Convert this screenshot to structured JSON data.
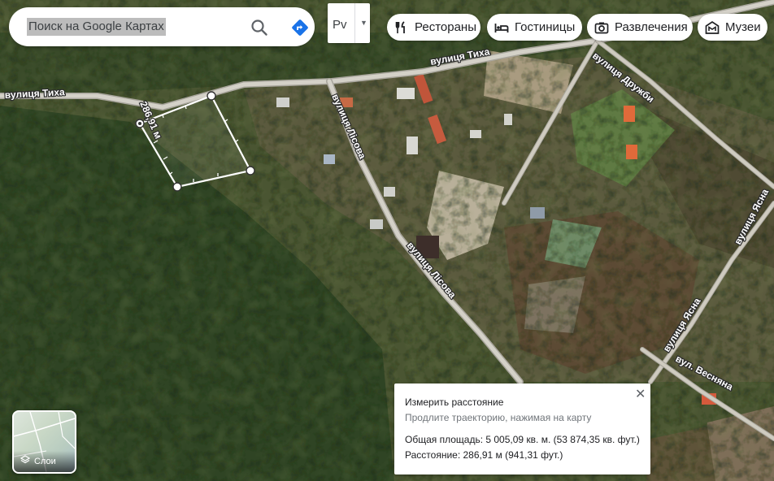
{
  "search": {
    "placeholder": "Поиск на Google Картах",
    "search_icon": "search-icon",
    "directions_icon": "directions-icon"
  },
  "language": {
    "label": "Pv",
    "dropdown_icon": "caret-down-icon"
  },
  "categories": [
    {
      "label": "Рестораны",
      "icon": "restaurant-icon"
    },
    {
      "label": "Гостиницы",
      "icon": "hotel-icon"
    },
    {
      "label": "Развлечения",
      "icon": "camera-icon"
    },
    {
      "label": "Музеи",
      "icon": "museum-icon"
    }
  ],
  "map": {
    "streets": [
      "вулиця Тиха",
      "вулиця Тиха",
      "вулиця Лісова",
      "вулиця Лісова",
      "вулиця Дружби",
      "вулиця Ясна",
      "вулиця Ясна",
      "вул. Весняна"
    ],
    "measure_label": "286,91 м",
    "colors": {
      "measure_line": "#ffffff",
      "road": "#c9c6bd",
      "street_label": "#ffffff"
    }
  },
  "layers": {
    "label": "Слои",
    "icon": "layers-icon"
  },
  "measure": {
    "title": "Измерить расстояние",
    "hint": "Продлите траекторию, нажимая на карту",
    "area": "Общая площадь: 5 005,09 кв. м. (53 874,35 кв. фут.)",
    "distance": "Расстояние: 286,91 м (941,31 фут.)",
    "close_label": "✕"
  }
}
